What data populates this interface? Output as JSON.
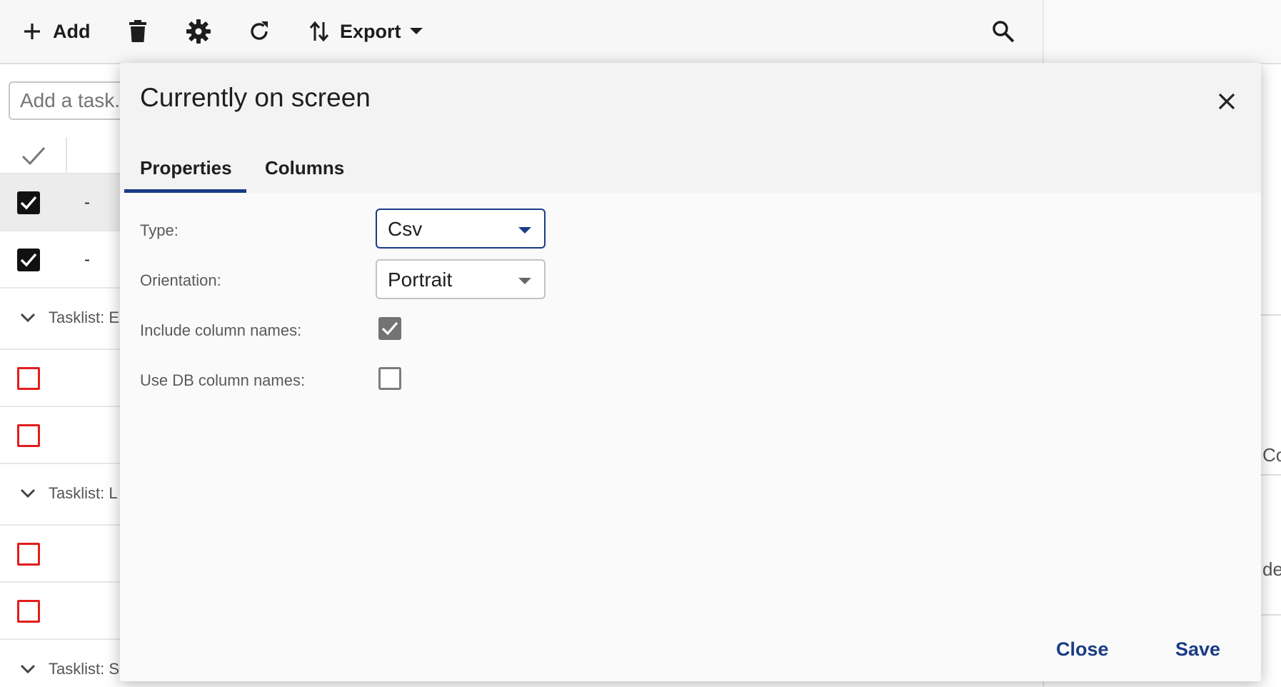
{
  "toolbar": {
    "add_label": "Add",
    "export_label": "Export",
    "icons": [
      "plus-icon",
      "trash-icon",
      "gear-icon",
      "refresh-icon",
      "sort-arrows-icon",
      "caret-down-icon",
      "search-icon"
    ]
  },
  "task_input": {
    "placeholder": "Add a task..."
  },
  "task_rows": [
    {
      "checked": true,
      "text": "-"
    },
    {
      "checked": true,
      "text": "-"
    }
  ],
  "groups": [
    {
      "label": "Tasklist: E",
      "rows": 2
    },
    {
      "label": "Tasklist: L",
      "rows": 2
    },
    {
      "label": "Tasklist: S",
      "rows": 0
    }
  ],
  "right_panel": {
    "snippets": [
      "Co",
      "de"
    ]
  },
  "modal": {
    "title": "Currently on screen",
    "tabs": [
      {
        "label": "Properties",
        "active": true
      },
      {
        "label": "Columns",
        "active": false
      }
    ],
    "fields": {
      "type": {
        "label": "Type:",
        "value": "Csv"
      },
      "orientation": {
        "label": "Orientation:",
        "value": "Portrait"
      },
      "include_column_names": {
        "label": "Include column names:",
        "checked": true
      },
      "use_db_column_names": {
        "label": "Use DB column names:",
        "checked": false
      }
    },
    "buttons": {
      "close": "Close",
      "save": "Save"
    }
  },
  "colors": {
    "accent": "#1a3c85",
    "unchecked_task_border": "#e21d1d"
  }
}
